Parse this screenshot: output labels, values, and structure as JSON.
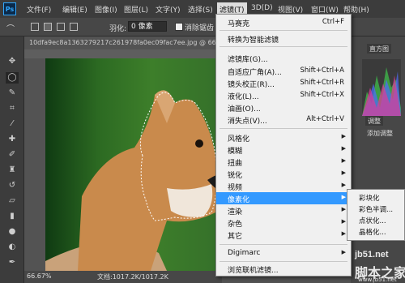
{
  "menubar": {
    "items": [
      "文件(F)",
      "编辑(E)",
      "图像(I)",
      "图层(L)",
      "文字(Y)",
      "选择(S)",
      "滤镜(T)",
      "3D(D)",
      "视图(V)",
      "窗口(W)",
      "帮助(H)"
    ],
    "active_label": "滤镜(T)"
  },
  "options": {
    "feather_label": "羽化:",
    "feather_value": "0 像素",
    "antialias_label": "消除锯齿"
  },
  "document": {
    "tab_title": "10dfa9ec8a1363279217c261978fa0ec09fac7ee.jpg @ 66.7%..."
  },
  "status": {
    "zoom": "66.67%",
    "doc_info": "文档:1017.2K/1017.2K"
  },
  "right_panel": {
    "histogram_tab": "直方图",
    "adjust_tab": "调整",
    "add_adjust": "添加调整"
  },
  "filter_menu": {
    "items": [
      {
        "label": "马赛克",
        "shortcut": "Ctrl+F"
      },
      {
        "label": "转换为智能滤镜",
        "shortcut": ""
      },
      {
        "label": "滤镜库(G)...",
        "shortcut": ""
      },
      {
        "label": "自适应广角(A)...",
        "shortcut": "Shift+Ctrl+A"
      },
      {
        "label": "镜头校正(R)...",
        "shortcut": "Shift+Ctrl+R"
      },
      {
        "label": "液化(L)...",
        "shortcut": "Shift+Ctrl+X"
      },
      {
        "label": "油画(O)...",
        "shortcut": ""
      },
      {
        "label": "消失点(V)...",
        "shortcut": "Alt+Ctrl+V"
      },
      {
        "label": "风格化",
        "shortcut": ""
      },
      {
        "label": "模糊",
        "shortcut": ""
      },
      {
        "label": "扭曲",
        "shortcut": ""
      },
      {
        "label": "锐化",
        "shortcut": ""
      },
      {
        "label": "视频",
        "shortcut": ""
      },
      {
        "label": "像素化",
        "shortcut": ""
      },
      {
        "label": "渲染",
        "shortcut": ""
      },
      {
        "label": "杂色",
        "shortcut": ""
      },
      {
        "label": "其它",
        "shortcut": ""
      },
      {
        "label": "Digimarc",
        "shortcut": ""
      },
      {
        "label": "浏览联机滤镜...",
        "shortcut": ""
      }
    ],
    "highlighted": "像素化"
  },
  "submenu": {
    "items": [
      "彩块化",
      "彩色半调...",
      "点状化...",
      "晶格化..."
    ]
  },
  "watermark": {
    "line1": "jb51.net",
    "line2": "脚本之家",
    "line3": "www.jb51.net"
  },
  "colors": {
    "highlight": "#3399ff",
    "menu_bg": "#f0f0f0",
    "chrome": "#3c3c3c"
  }
}
